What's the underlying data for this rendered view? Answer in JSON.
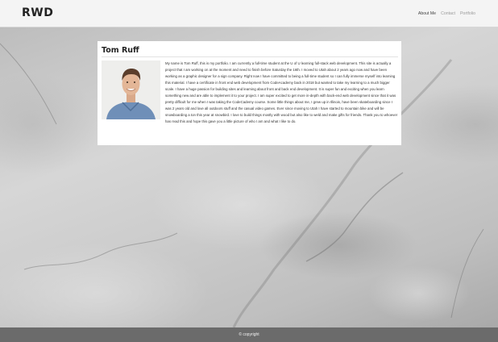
{
  "header": {
    "logo": "RWD",
    "nav": [
      {
        "label": "About Me",
        "active": true
      },
      {
        "label": "Contact",
        "active": false
      },
      {
        "label": "Portfolio",
        "active": false
      }
    ]
  },
  "profile": {
    "name": "Tom Ruff",
    "photo_icon": "portrait-photo",
    "bio": "My name is Tom Ruff, this is my portfolio. I am currently a full-time student at the U of U learning full-stack web development. This site is actually a project that I am working on at the moment and need to finish before Saturday the 16th. I moved to Utah about 2 years ago now and have been working as a graphic designer for a sign company. Right now I have committed to being a full-time student so I can fully immerse myself into learning this material. I have a certificate in front end web development from CodeAcademy back in 2018 but wanted to take my learning to a much bigger scale. I have a huge passion for building sites and learning about front and back end development. It is super fun and exciting when you learn something new and are able to implement it to your project. I am super excited to get more in-depth with back-end web development since that it was pretty difficult for me when I was taking the CodeCademy course. Some little things about me, I grew up in Illinois, have been skateboarding since I was 2 years old and love all outdoors stuff and the casual video games. Ever since moving to Utah I have started to mountain bike and will be snowboarding a ton this year at snowbird. I love to build things mostly with wood but also like to weld and make gifts for friends. Thank you to whoever has read this and hope this gave you a little picture of who I am and what I like to do."
  },
  "footer": {
    "copyright": "© copyright"
  },
  "colors": {
    "header_bg": "#f4f4f4",
    "footer_bg": "#6b6b6b",
    "card_bg": "#ffffff",
    "nav_active": "#444444",
    "nav_inactive": "#9a9a9a"
  }
}
